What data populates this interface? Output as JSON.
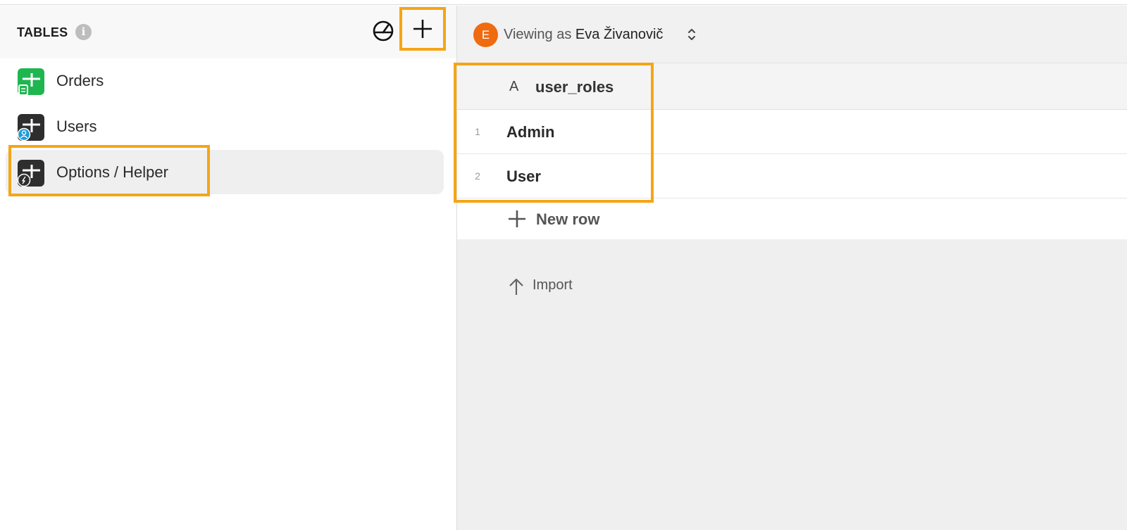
{
  "sidebar": {
    "title": "TABLES",
    "info_glyph": "i",
    "tables": [
      {
        "label": "Orders",
        "icon": "sheet-table-icon"
      },
      {
        "label": "Users",
        "icon": "users-table-icon"
      },
      {
        "label": "Options / Helper",
        "icon": "helper-table-icon",
        "selected": true
      }
    ]
  },
  "main": {
    "viewer": {
      "avatar_initial": "E",
      "prefix": "Viewing as",
      "name": "Eva Živanovič"
    },
    "column": {
      "type_glyph": "A",
      "name": "user_roles"
    },
    "rows": [
      {
        "num": "1",
        "value": "Admin"
      },
      {
        "num": "2",
        "value": "User"
      }
    ],
    "new_row_label": "New row",
    "import_label": "Import"
  },
  "colors": {
    "highlight": "#f5a516",
    "avatar": "#f06a0f",
    "orders_icon": "#1fb650",
    "users_badge": "#1e9bd7"
  }
}
